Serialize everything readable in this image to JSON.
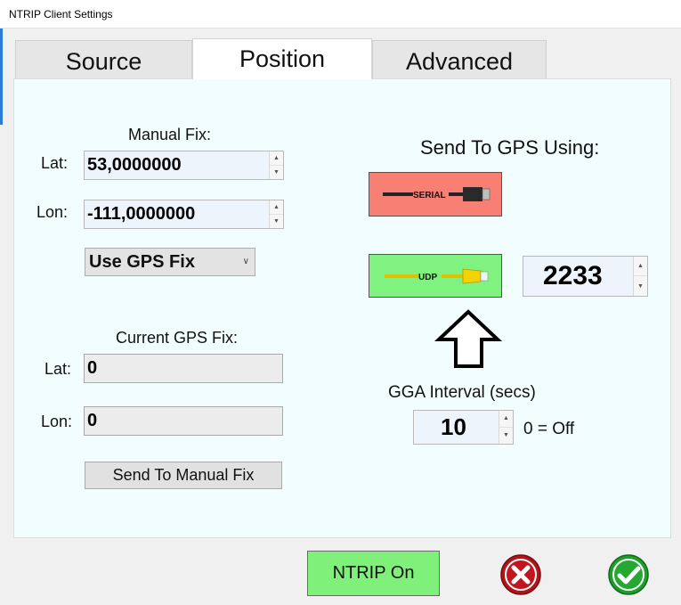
{
  "window": {
    "title": "NTRIP Client Settings"
  },
  "tabs": [
    {
      "label": "Source"
    },
    {
      "label": "Position"
    },
    {
      "label": "Advanced"
    }
  ],
  "manual_fix": {
    "heading": "Manual Fix:",
    "lat_label": "Lat:",
    "lat_value": "53,0000000",
    "lon_label": "Lon:",
    "lon_value": "-111,0000000",
    "mode_selected": "Use GPS Fix"
  },
  "current_fix": {
    "heading": "Current GPS Fix:",
    "lat_label": "Lat:",
    "lat_value": "0",
    "lon_label": "Lon:",
    "lon_value": "0",
    "send_button": "Send To Manual Fix"
  },
  "send_to_gps": {
    "heading": "Send To GPS Using:",
    "serial_label": "SERIAL",
    "udp_label": "UDP",
    "udp_port": "2233"
  },
  "gga": {
    "heading": "GGA Interval (secs)",
    "value": "10",
    "hint": "0 = Off"
  },
  "footer": {
    "ntrip_button": "NTRIP On"
  },
  "colors": {
    "serial_bg": "#f87f73",
    "udp_bg": "#7ff27f",
    "ntrip_bg": "#7ff07a",
    "cancel": "#b0141c",
    "ok": "#1f9e2a",
    "panel_bg": "#f2fefe"
  },
  "icons": {
    "serial": "usb-plug-icon",
    "udp": "ethernet-plug-icon",
    "arrow": "up-arrow-icon",
    "cancel": "cancel-icon",
    "ok": "ok-check-icon"
  }
}
